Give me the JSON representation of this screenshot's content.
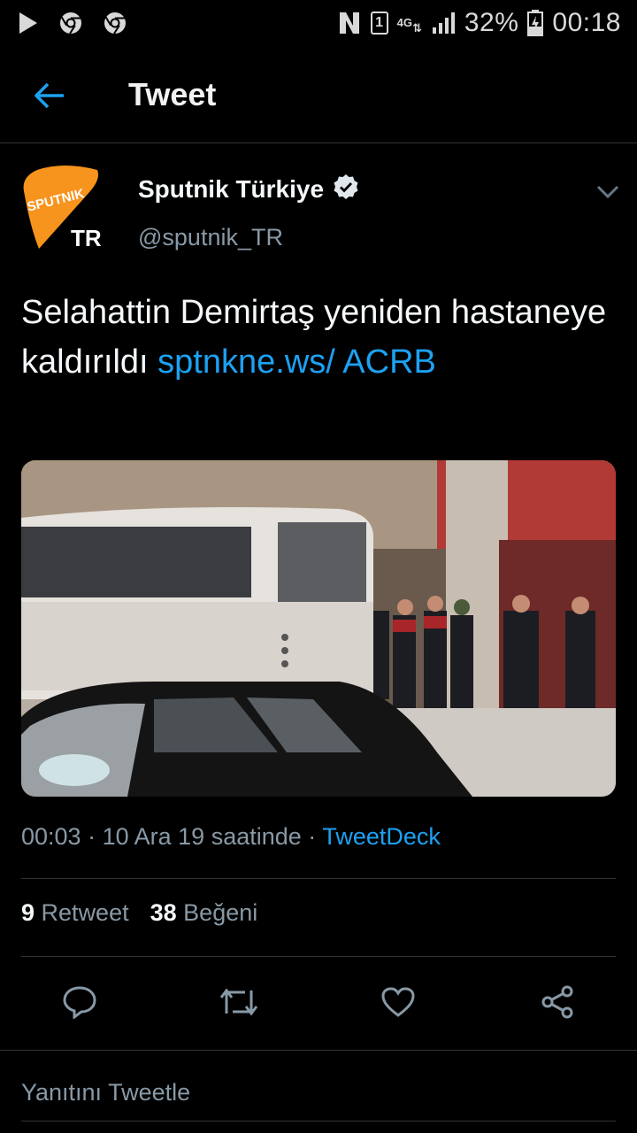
{
  "status_bar": {
    "battery": "32%",
    "time": "00:18",
    "network": "4G",
    "sim": "1",
    "icons": [
      "play-icon",
      "chrome-icon",
      "chrome-icon",
      "nfc-icon",
      "sim-icon",
      "network-4g-icon",
      "signal-icon",
      "battery-icon"
    ]
  },
  "header": {
    "title": "Tweet",
    "back_icon": "back-arrow-icon"
  },
  "tweet": {
    "author_name": "Sputnik Türkiye",
    "author_handle": "@sputnik_TR",
    "avatar_logo_text": "SPUTNIK",
    "avatar_logo_suffix": "TR",
    "text_plain": "Selahattin Demirtaş yeniden hastaneye kaldırıldı ",
    "link_text": "sptnkne.ws/ ACRB",
    "time": "00:03",
    "date": "10 Ara 19 saatinde",
    "source": "TweetDeck",
    "retweet_count": "9",
    "retweet_label": "Retweet",
    "like_count": "38",
    "like_label": "Beğeni"
  },
  "reply": {
    "placeholder": "Yanıtını Tweetle"
  },
  "colors": {
    "background": "#000000",
    "accent": "#1da1f2",
    "muted": "#8899a6",
    "divider": "#2f3336",
    "logo_orange": "#f7941d"
  }
}
